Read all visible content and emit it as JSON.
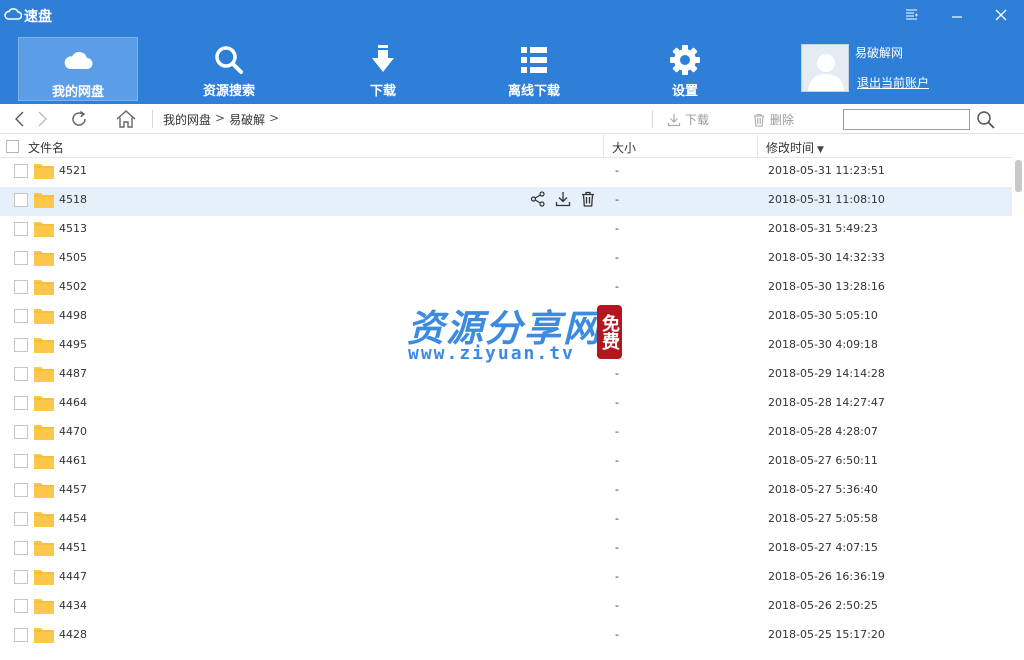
{
  "window": {
    "title": "速盘"
  },
  "nav": {
    "items": [
      {
        "label": "我的网盘",
        "icon": "cloud-icon",
        "active": true
      },
      {
        "label": "资源搜索",
        "icon": "search-icon",
        "active": false
      },
      {
        "label": "下载",
        "icon": "download-arrow-icon",
        "active": false
      },
      {
        "label": "离线下载",
        "icon": "list-icon",
        "active": false
      },
      {
        "label": "设置",
        "icon": "gear-icon",
        "active": false
      }
    ]
  },
  "user": {
    "name": "易破解网",
    "logout": "退出当前账户"
  },
  "toolbar": {
    "breadcrumb": [
      "我的网盘",
      "易破解"
    ],
    "download_label": "下载",
    "delete_label": "删除",
    "search_placeholder": ""
  },
  "columns": {
    "name": "文件名",
    "size": "大小",
    "time": "修改时间"
  },
  "files": [
    {
      "name": "4521",
      "size": "-",
      "time": "2018-05-31 11:23:51"
    },
    {
      "name": "4518",
      "size": "-",
      "time": "2018-05-31 11:08:10"
    },
    {
      "name": "4513",
      "size": "-",
      "time": "2018-05-31 5:49:23"
    },
    {
      "name": "4505",
      "size": "-",
      "time": "2018-05-30 14:32:33"
    },
    {
      "name": "4502",
      "size": "-",
      "time": "2018-05-30 13:28:16"
    },
    {
      "name": "4498",
      "size": "-",
      "time": "2018-05-30 5:05:10"
    },
    {
      "name": "4495",
      "size": "-",
      "time": "2018-05-30 4:09:18"
    },
    {
      "name": "4487",
      "size": "-",
      "time": "2018-05-29 14:14:28"
    },
    {
      "name": "4464",
      "size": "-",
      "time": "2018-05-28 14:27:47"
    },
    {
      "name": "4470",
      "size": "-",
      "time": "2018-05-28 4:28:07"
    },
    {
      "name": "4461",
      "size": "-",
      "time": "2018-05-27 6:50:11"
    },
    {
      "name": "4457",
      "size": "-",
      "time": "2018-05-27 5:36:40"
    },
    {
      "name": "4454",
      "size": "-",
      "time": "2018-05-27 5:05:58"
    },
    {
      "name": "4451",
      "size": "-",
      "time": "2018-05-27 4:07:15"
    },
    {
      "name": "4447",
      "size": "-",
      "time": "2018-05-26 16:36:19"
    },
    {
      "name": "4434",
      "size": "-",
      "time": "2018-05-26 2:50:25"
    },
    {
      "name": "4428",
      "size": "-",
      "time": "2018-05-25 15:17:20"
    }
  ],
  "hovered_row": 1,
  "watermark": {
    "title": "资源分享网",
    "url": "www.ziyuan.tv",
    "stamp": "免费"
  },
  "colors": {
    "header_bg": "#2e7fd8",
    "nav_active": "#5b9de6",
    "row_hover": "#e5f0fb",
    "folder": "#fcc74a",
    "watermark": "#3d8be0",
    "stamp": "#b3171d"
  }
}
